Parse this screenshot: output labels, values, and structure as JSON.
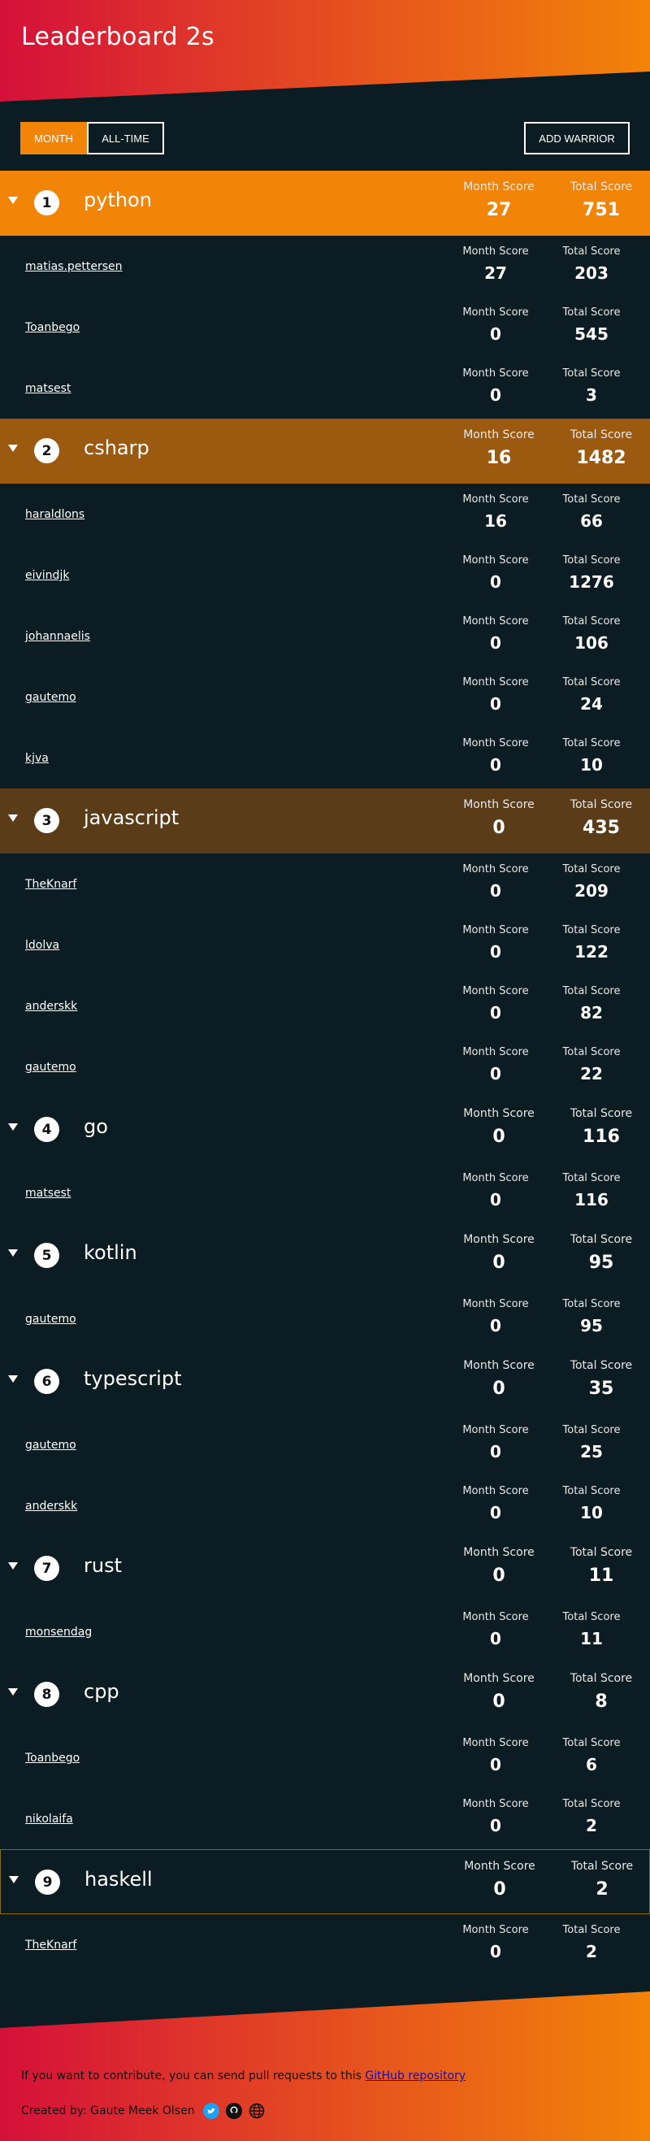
{
  "app": {
    "title": "Leaderboard 2s"
  },
  "controls": {
    "month_label": "MONTH",
    "alltime_label": "ALL-TIME",
    "add_label": "ADD WARRIOR"
  },
  "labels": {
    "month_score": "Month Score",
    "total_score": "Total Score"
  },
  "colors": {
    "rank1": "#f28408",
    "rank2": "#9b5a10",
    "rank3": "#5a3d18",
    "selected_border": "#8a6a10",
    "background": "#0b1d22"
  },
  "languages": [
    {
      "rank": "1",
      "name": "python",
      "month": "27",
      "total": "751",
      "users": [
        {
          "name": "matias.pettersen",
          "month": "27",
          "total": "203"
        },
        {
          "name": "Toanbego",
          "month": "0",
          "total": "545"
        },
        {
          "name": "matsest",
          "month": "0",
          "total": "3"
        }
      ]
    },
    {
      "rank": "2",
      "name": "csharp",
      "month": "16",
      "total": "1482",
      "users": [
        {
          "name": "haraldlons",
          "month": "16",
          "total": "66"
        },
        {
          "name": "eivindjk",
          "month": "0",
          "total": "1276"
        },
        {
          "name": "johannaelis",
          "month": "0",
          "total": "106"
        },
        {
          "name": "gautemo",
          "month": "0",
          "total": "24"
        },
        {
          "name": "kjva",
          "month": "0",
          "total": "10"
        }
      ]
    },
    {
      "rank": "3",
      "name": "javascript",
      "month": "0",
      "total": "435",
      "users": [
        {
          "name": "TheKnarf",
          "month": "0",
          "total": "209"
        },
        {
          "name": "ldolva",
          "month": "0",
          "total": "122"
        },
        {
          "name": "anderskk",
          "month": "0",
          "total": "82"
        },
        {
          "name": "gautemo",
          "month": "0",
          "total": "22"
        }
      ]
    },
    {
      "rank": "4",
      "name": "go",
      "month": "0",
      "total": "116",
      "users": [
        {
          "name": "matsest",
          "month": "0",
          "total": "116"
        }
      ]
    },
    {
      "rank": "5",
      "name": "kotlin",
      "month": "0",
      "total": "95",
      "users": [
        {
          "name": "gautemo",
          "month": "0",
          "total": "95"
        }
      ]
    },
    {
      "rank": "6",
      "name": "typescript",
      "month": "0",
      "total": "35",
      "users": [
        {
          "name": "gautemo",
          "month": "0",
          "total": "25"
        },
        {
          "name": "anderskk",
          "month": "0",
          "total": "10"
        }
      ]
    },
    {
      "rank": "7",
      "name": "rust",
      "month": "0",
      "total": "11",
      "users": [
        {
          "name": "monsendag",
          "month": "0",
          "total": "11"
        }
      ]
    },
    {
      "rank": "8",
      "name": "cpp",
      "month": "0",
      "total": "8",
      "users": [
        {
          "name": "Toanbego",
          "month": "0",
          "total": "6"
        },
        {
          "name": "nikolaifa",
          "month": "0",
          "total": "2"
        }
      ]
    },
    {
      "rank": "9",
      "name": "haskell",
      "month": "0",
      "total": "2",
      "users": [
        {
          "name": "TheKnarf",
          "month": "0",
          "total": "2"
        }
      ]
    }
  ],
  "footer": {
    "contribute_text": "If you want to contribute, you can send pull requests to this ",
    "repo_link": "GitHub repository",
    "created_by": "Created by: Gaute Meek Olsen",
    "icons": [
      "twitter-icon",
      "github-icon",
      "globe-icon"
    ]
  }
}
